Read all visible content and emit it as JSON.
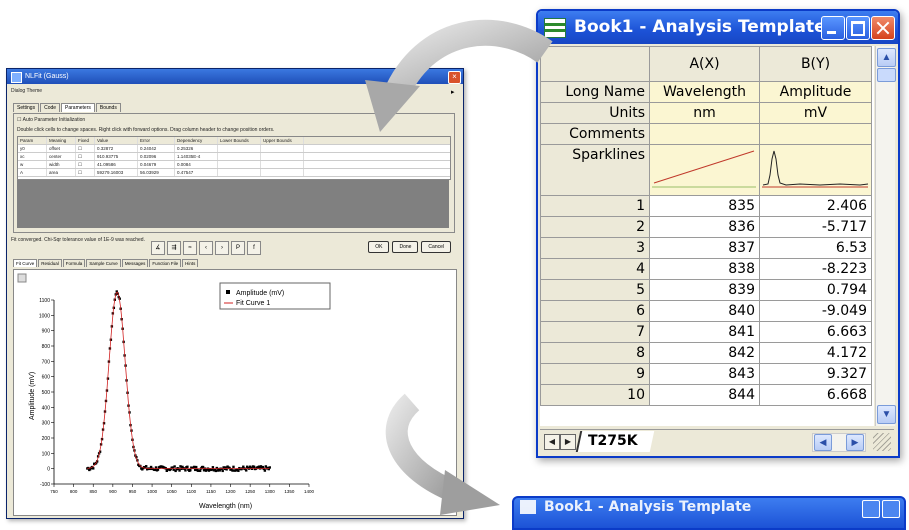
{
  "nlfit": {
    "title": "NLFit (Gauss)",
    "dialog_theme": "Dialog Theme",
    "tabs": [
      "Settings",
      "Code",
      "Parameters",
      "Bounds"
    ],
    "active_tab": "Parameters",
    "auto_init": "Auto Parameter Initialization",
    "hint": "Double click cells to change spaces. Right click with forward options. Drag column header to change position orders.",
    "param_headers": [
      "Param",
      "Meaning",
      "Fixed",
      "Value",
      "Error",
      "Dependency",
      "Lower Bounds",
      "Upper Bounds"
    ],
    "params": [
      [
        "y0",
        "offset",
        "",
        "0.32872",
        "0.24042",
        "0.25326",
        "",
        ""
      ],
      [
        "xc",
        "center",
        "",
        "910.93775",
        "0.02096",
        "1.14035E-4",
        "",
        ""
      ],
      [
        "w",
        "width",
        "",
        "41.09586",
        "0.04679",
        "0.0084",
        "",
        ""
      ],
      [
        "A",
        "area",
        "",
        "59279.16003",
        "56.03929",
        "0.47547",
        "",
        ""
      ]
    ],
    "status": "Fit converged. Chi-Sqr tolerance value of 1E-9 was reached.",
    "buttons": [
      "OK",
      "Done",
      "Cancel"
    ],
    "bottom_tabs": [
      "Fit Curve",
      "Residual",
      "Formula",
      "Sample Curve",
      "Messages",
      "Function File",
      "Hints"
    ],
    "active_bottom_tab": "Fit Curve",
    "legend": [
      "Amplitude (mV)",
      "Fit Curve 1"
    ],
    "xlabel": "Wavelength (nm)",
    "ylabel": "Amplitude (mV)",
    "yticks": [
      "1100",
      "1000",
      "900",
      "800",
      "700",
      "600",
      "500",
      "400",
      "300",
      "200",
      "100",
      "0",
      "-100"
    ],
    "xticks": [
      "750",
      "800",
      "850",
      "900",
      "950",
      "1000",
      "1050",
      "1100",
      "1150",
      "1200",
      "1250",
      "1300",
      "1350",
      "1400"
    ]
  },
  "book": {
    "title": "Book1 - Analysis Template",
    "col_headers": [
      "A(X)",
      "B(Y)"
    ],
    "label_rows": [
      {
        "label": "Long Name",
        "a": "Wavelength",
        "b": "Amplitude"
      },
      {
        "label": "Units",
        "a": "nm",
        "b": "mV"
      },
      {
        "label": "Comments",
        "a": "",
        "b": ""
      }
    ],
    "sparklines_label": "Sparklines",
    "rows": [
      {
        "n": "1",
        "a": "835",
        "b": "2.406"
      },
      {
        "n": "2",
        "a": "836",
        "b": "-5.717"
      },
      {
        "n": "3",
        "a": "837",
        "b": "6.53"
      },
      {
        "n": "4",
        "a": "838",
        "b": "-8.223"
      },
      {
        "n": "5",
        "a": "839",
        "b": "0.794"
      },
      {
        "n": "6",
        "a": "840",
        "b": "-9.049"
      },
      {
        "n": "7",
        "a": "841",
        "b": "6.663"
      },
      {
        "n": "8",
        "a": "842",
        "b": "4.172"
      },
      {
        "n": "9",
        "a": "843",
        "b": "9.327"
      },
      {
        "n": "10",
        "a": "844",
        "b": "6.668"
      }
    ],
    "sheet_tab": "T275K",
    "colors": {
      "title_bar": "#1c52d6",
      "label_cells": "#fbf6d2",
      "spark_line": "#c0392b"
    }
  },
  "book2": {
    "title": "Book1 - Analysis Template"
  }
}
